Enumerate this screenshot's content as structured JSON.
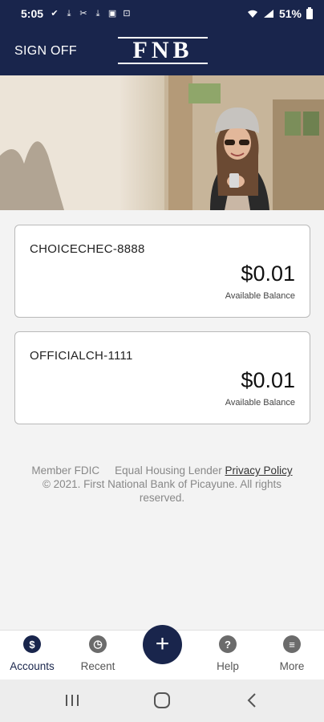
{
  "status_bar": {
    "time": "5:05",
    "battery": "51%",
    "notification_icons": [
      "check-circle-icon",
      "download-icon",
      "tools-icon",
      "download-icon",
      "image-icon",
      "screenshot-icon"
    ]
  },
  "header": {
    "sign_off_label": "SIGN OFF",
    "logo_text": "FNB",
    "bg_color": "#19254c"
  },
  "accounts": [
    {
      "name": "CHOICECHEC-8888",
      "balance": "$0.01",
      "balance_label": "Available Balance"
    },
    {
      "name": "OFFICIALCH-1111",
      "balance": "$0.01",
      "balance_label": "Available Balance"
    }
  ],
  "footer": {
    "member_fdic": "Member FDIC",
    "equal_housing": "Equal Housing Lender",
    "privacy_policy": "Privacy Policy",
    "copyright": "© 2021. First National Bank of Picayune. All rights reserved."
  },
  "tabbar": {
    "accounts": "Accounts",
    "recent": "Recent",
    "add": "+",
    "help": "Help",
    "more": "More"
  }
}
